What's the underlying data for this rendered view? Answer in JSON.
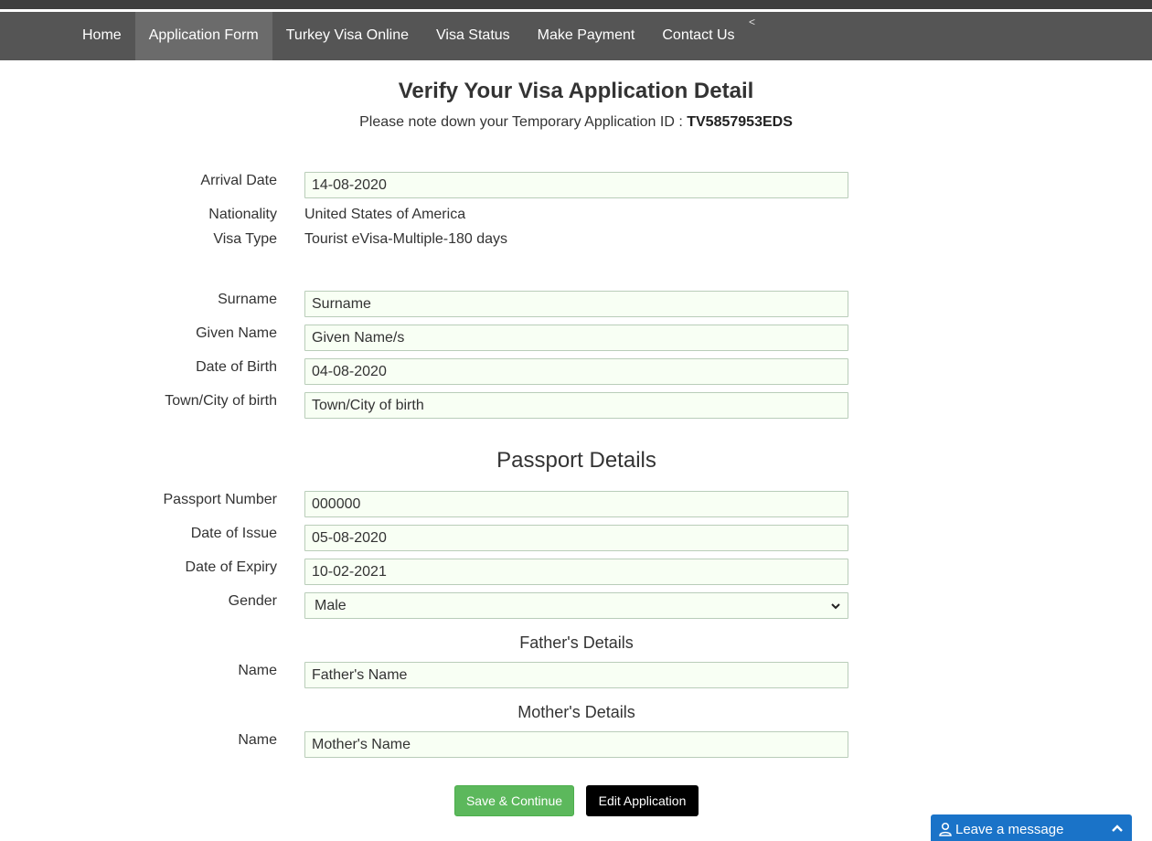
{
  "nav": {
    "items": [
      {
        "label": "Home",
        "active": false
      },
      {
        "label": "Application Form",
        "active": true
      },
      {
        "label": "Turkey Visa Online",
        "active": false
      },
      {
        "label": "Visa Status",
        "active": false
      },
      {
        "label": "Make Payment",
        "active": false
      },
      {
        "label": "Contact Us",
        "active": false
      }
    ],
    "caret": "<"
  },
  "page": {
    "title": "Verify Your Visa Application Detail",
    "note_prefix": "Please note down your Temporary Application ID : ",
    "application_id": "TV5857953EDS"
  },
  "trip": {
    "arrival_date_label": "Arrival Date",
    "arrival_date_value": "14-08-2020",
    "nationality_label": "Nationality",
    "nationality_value": "United States of America",
    "visa_type_label": "Visa Type",
    "visa_type_value": "Tourist eVisa-Multiple-180 days"
  },
  "personal": {
    "surname_label": "Surname",
    "surname_value": "Surname",
    "given_name_label": "Given Name",
    "given_name_value": "Given Name/s",
    "dob_label": "Date of Birth",
    "dob_value": "04-08-2020",
    "birth_town_label": "Town/City of birth",
    "birth_town_value": "Town/City of birth"
  },
  "passport": {
    "heading": "Passport Details",
    "number_label": "Passport Number",
    "number_value": "000000",
    "issue_label": "Date of Issue",
    "issue_value": "05-08-2020",
    "expiry_label": "Date of Expiry",
    "expiry_value": "10-02-2021",
    "gender_label": "Gender",
    "gender_value": "Male"
  },
  "father": {
    "heading": "Father's Details",
    "name_label": "Name",
    "name_value": "Father's Name"
  },
  "mother": {
    "heading": "Mother's Details",
    "name_label": "Name",
    "name_value": "Mother's Name"
  },
  "actions": {
    "save_label": "Save & Continue",
    "edit_label": "Edit Application"
  },
  "chat": {
    "label": "Leave a message",
    "user_icon": "user-icon",
    "expand_icon": "chevron-up-icon"
  },
  "colors": {
    "navbar": "#555555",
    "nav_active": "#6b6b6b",
    "field_bg": "#f8fff4",
    "save_button": "#5cb85c",
    "edit_button": "#000000",
    "chat_widget": "#1a73c8"
  }
}
